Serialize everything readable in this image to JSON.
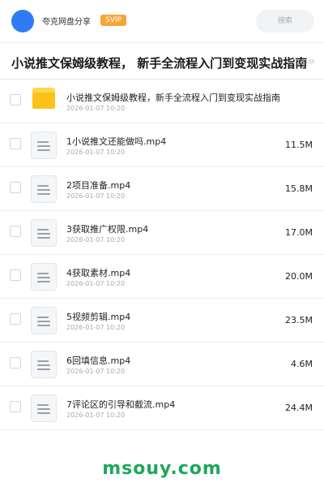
{
  "header": {
    "app_name": "夸克网盘分享",
    "badge": "SVIP",
    "search_placeholder": "搜索"
  },
  "share": {
    "title": "小说推文保姆级教程， 新手全流程入门到变现实战指南",
    "size": "181M"
  },
  "files": [
    {
      "type": "folder",
      "name": "小说推文保姆级教程，新手全流程入门到变现实战指南",
      "date": "2026-01-07 10:20",
      "size": ""
    },
    {
      "type": "file",
      "name": "1小说推文还能做吗.mp4",
      "date": "2026-01-07 10:20",
      "size": "11.5M"
    },
    {
      "type": "file",
      "name": "2项目准备.mp4",
      "date": "2026-01-07 10:20",
      "size": "15.8M"
    },
    {
      "type": "file",
      "name": "3获取推广权限.mp4",
      "date": "2026-01-07 10:20",
      "size": "17.0M"
    },
    {
      "type": "file",
      "name": "4获取素材.mp4",
      "date": "2026-01-07 10:20",
      "size": "20.0M"
    },
    {
      "type": "file",
      "name": "5视频剪辑.mp4",
      "date": "2026-01-07 10:20",
      "size": "23.5M"
    },
    {
      "type": "file",
      "name": "6回填信息.mp4",
      "date": "2026-01-07 10:20",
      "size": "4.6M"
    },
    {
      "type": "file",
      "name": "7评论区的引导和截流.mp4",
      "date": "2026-01-07 10:20",
      "size": "24.4M"
    }
  ],
  "watermark": "msouy.com",
  "colors": {
    "avatar": "#2f7bf6",
    "svip_badge": "#f7a53a",
    "folder": "#fdc21a",
    "watermark": "#1ea75a"
  }
}
